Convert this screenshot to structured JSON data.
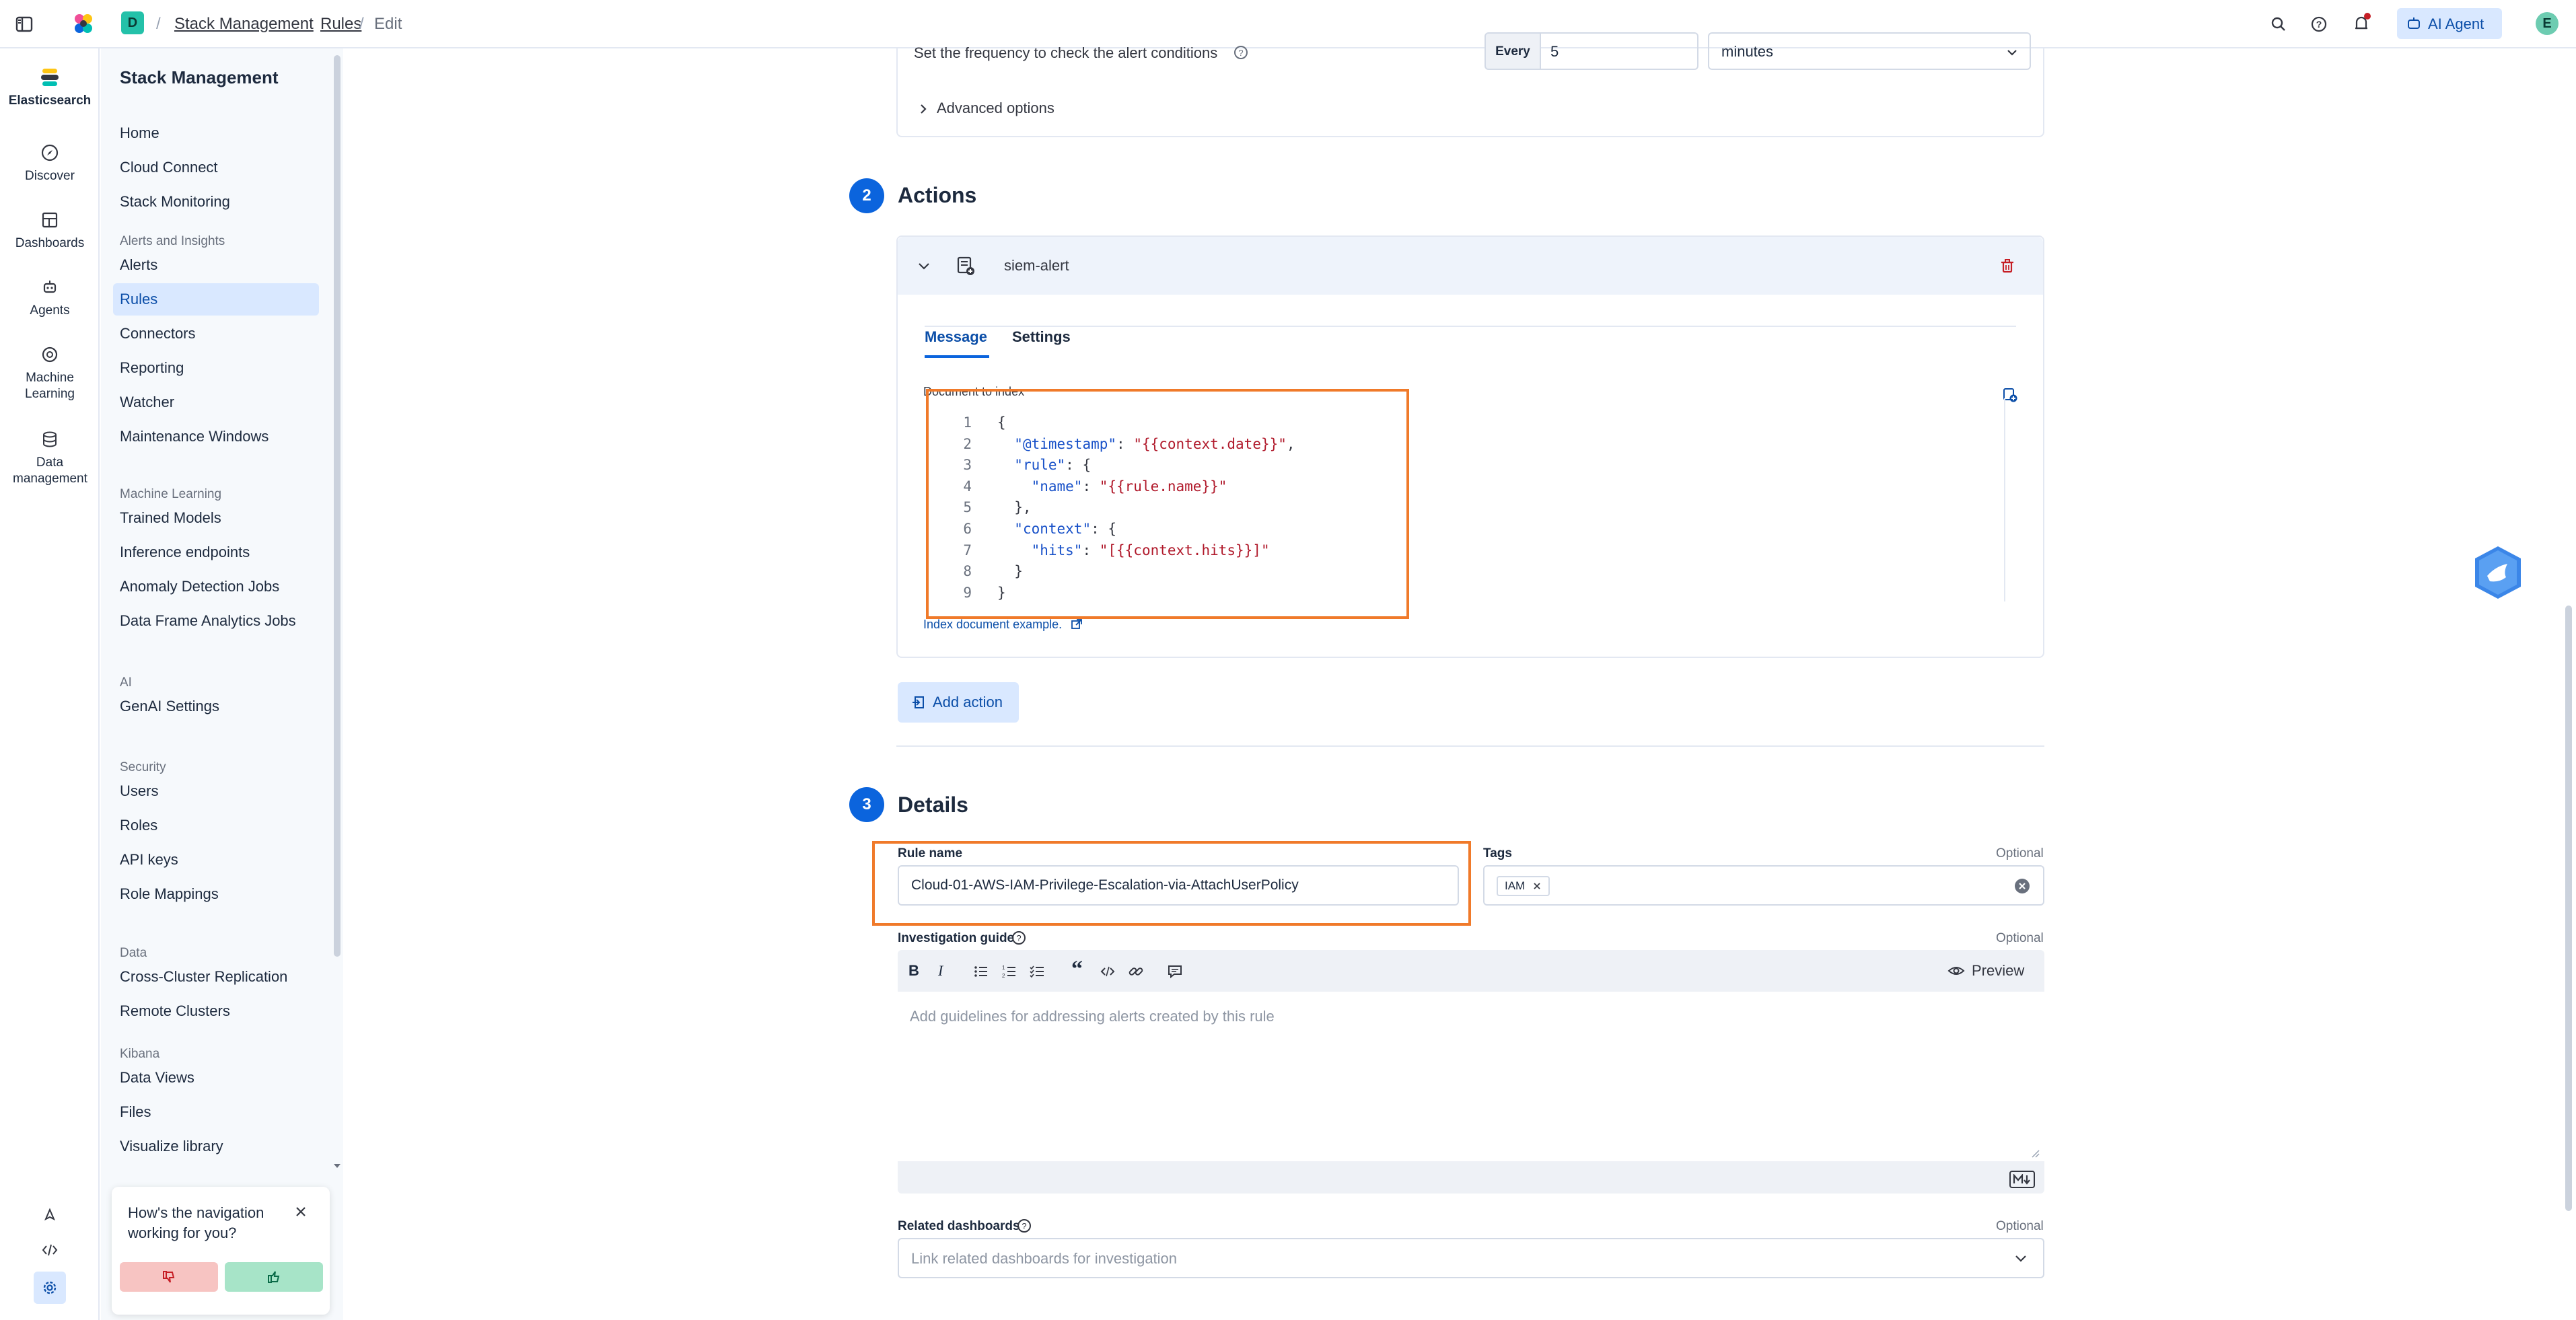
{
  "topbar": {
    "space_initial": "D",
    "breadcrumbs": [
      "Stack Management",
      "Rules",
      "Edit"
    ],
    "ai_agent_label": "AI Agent",
    "avatar_initial": "E"
  },
  "rail": {
    "brand_label": "Elasticsearch",
    "items": [
      "Discover",
      "Dashboards",
      "Agents",
      "Machine Learning",
      "Data management"
    ]
  },
  "sidenav": {
    "title": "Stack Management",
    "top_items": [
      "Home",
      "Cloud Connect",
      "Stack Monitoring"
    ],
    "groups": [
      {
        "title": "Alerts and Insights",
        "items": [
          "Alerts",
          "Rules",
          "Connectors",
          "Reporting",
          "Watcher",
          "Maintenance Windows"
        ]
      },
      {
        "title": "Machine Learning",
        "items": [
          "Trained Models",
          "Inference endpoints",
          "Anomaly Detection Jobs",
          "Data Frame Analytics Jobs"
        ]
      },
      {
        "title": "AI",
        "items": [
          "GenAI Settings"
        ]
      },
      {
        "title": "Security",
        "items": [
          "Users",
          "Roles",
          "API keys",
          "Role Mappings"
        ]
      },
      {
        "title": "Data",
        "items": [
          "Cross-Cluster Replication",
          "Remote Clusters"
        ]
      },
      {
        "title": "Kibana",
        "items": [
          "Data Views",
          "Files",
          "Visualize library"
        ]
      }
    ],
    "active_item": "Rules"
  },
  "feedback": {
    "question": "How's the navigation working for you?"
  },
  "schedule": {
    "text": "Set the frequency to check the alert conditions",
    "every_label": "Every",
    "interval_value": "5",
    "unit_value": "minutes",
    "advanced_label": "Advanced options"
  },
  "actions": {
    "step": "2",
    "title": "Actions",
    "connector_name": "siem-alert",
    "tabs": [
      "Message",
      "Settings"
    ],
    "active_tab": "Message",
    "doc_label": "Document to index",
    "code_lines": [
      {
        "n": "1",
        "parts": [
          [
            "p",
            "{"
          ]
        ]
      },
      {
        "n": "2",
        "parts": [
          [
            "p",
            "  "
          ],
          [
            "k",
            "\"@timestamp\""
          ],
          [
            "p",
            ": "
          ],
          [
            "s",
            "\"{{context.date}}\""
          ],
          [
            "p",
            ","
          ]
        ]
      },
      {
        "n": "3",
        "parts": [
          [
            "p",
            "  "
          ],
          [
            "k",
            "\"rule\""
          ],
          [
            "p",
            ": {"
          ]
        ]
      },
      {
        "n": "4",
        "parts": [
          [
            "p",
            "    "
          ],
          [
            "k",
            "\"name\""
          ],
          [
            "p",
            ": "
          ],
          [
            "s",
            "\"{{rule.name}}\""
          ]
        ]
      },
      {
        "n": "5",
        "parts": [
          [
            "p",
            "  },"
          ]
        ]
      },
      {
        "n": "6",
        "parts": [
          [
            "p",
            "  "
          ],
          [
            "k",
            "\"context\""
          ],
          [
            "p",
            ": {"
          ]
        ]
      },
      {
        "n": "7",
        "parts": [
          [
            "p",
            "    "
          ],
          [
            "k",
            "\"hits\""
          ],
          [
            "p",
            ": "
          ],
          [
            "s",
            "\"[{{context.hits}}]\""
          ]
        ]
      },
      {
        "n": "8",
        "parts": [
          [
            "p",
            "  }"
          ]
        ]
      },
      {
        "n": "9",
        "parts": [
          [
            "p",
            "}"
          ]
        ]
      }
    ],
    "example_link": "Index document example.",
    "add_action_label": "Add action"
  },
  "details": {
    "step": "3",
    "title": "Details",
    "rule_name_label": "Rule name",
    "rule_name_value": "Cloud-01-AWS-IAM-Privilege-Escalation-via-AttachUserPolicy",
    "tags_label": "Tags",
    "tags_optional": "Optional",
    "tags": [
      "IAM"
    ],
    "guide_label": "Investigation guide",
    "guide_optional": "Optional",
    "guide_placeholder": "Add guidelines for addressing alerts created by this rule",
    "preview_label": "Preview",
    "related_label": "Related dashboards",
    "related_optional": "Optional",
    "related_placeholder": "Link related dashboards for investigation"
  },
  "colors": {
    "primary": "#0b64dd",
    "highlight_outline": "#f07a2a",
    "active_nav_bg": "#d9e8ff",
    "danger": "#c61e25"
  }
}
